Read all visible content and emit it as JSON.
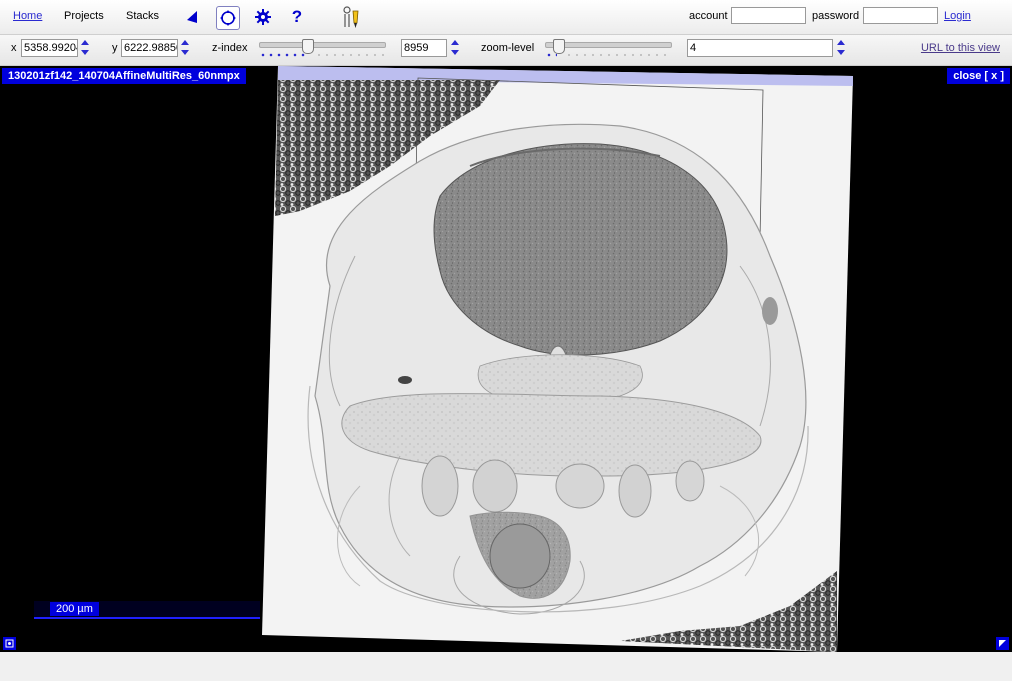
{
  "toolbar": {
    "home": "Home",
    "projects": "Projects",
    "stacks": "Stacks",
    "help": "?",
    "account_label": "account",
    "account_value": "",
    "password_label": "password",
    "password_value": "",
    "login": "Login",
    "icons": [
      "back-arrow-icon",
      "navigate-icon",
      "settings-gear-icon",
      "help-icon",
      "tracing-tool-icon"
    ]
  },
  "navigation": {
    "x_label": "x",
    "x_value": "5358.99204",
    "y_label": "y",
    "y_value": "6222.98850",
    "z_label": "z-index",
    "z_value": "8959",
    "z_slider_position": 0.38,
    "zoom_label": "zoom-level",
    "zoom_value": "4",
    "zoom_slider_position": 0.1,
    "url_link": "URL to this view"
  },
  "viewer": {
    "stack_title": "130201zf142_140704AffineMultiRes_60nmpx",
    "close": "close [ x ]",
    "scale_bar": "200 µm"
  },
  "colors": {
    "accent": "#0000dd",
    "link": "#2a2ad0",
    "viewer_background": "#000000"
  }
}
